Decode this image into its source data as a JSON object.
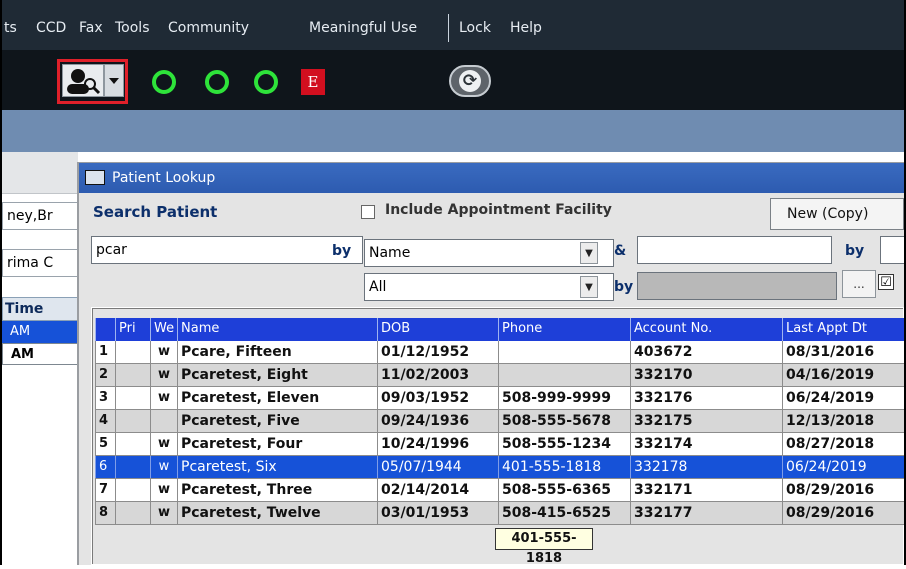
{
  "menu": {
    "items": [
      {
        "label": "ts"
      },
      {
        "label": "CCD"
      },
      {
        "label": "Fax"
      },
      {
        "label": "Tools"
      },
      {
        "label": "Community"
      },
      {
        "label": "Meaningful Use"
      },
      {
        "label": "Lock"
      },
      {
        "label": "Help"
      }
    ]
  },
  "toolbar": {
    "ef_icon_glyph": "E",
    "refresh_glyph": "⟳",
    "user_glyph": "👤",
    "dropdown_glyph": "▼"
  },
  "background_window": {
    "field1": "ney,Br",
    "field2": "rima C",
    "time_header": "Time",
    "rows": [
      "AM",
      "AM"
    ]
  },
  "dialog": {
    "title": "Patient Lookup",
    "search_patient_label": "Search Patient",
    "include_facility_label": "Include Appointment Facility",
    "new_copy_button": "New (Copy)",
    "search_value": "pcar",
    "by_label": "by",
    "by_label2": "by",
    "by_label3": "by",
    "amp_label": "&",
    "search_by_selected": "Name",
    "filter_selected": "All",
    "ellipsis": "...",
    "checkbox_glyph": "☑",
    "combo_arrow": "▼"
  },
  "grid": {
    "columns": [
      "",
      "Pri",
      "We",
      "Name",
      "DOB",
      "Phone",
      "Account No.",
      "Last Appt Dt"
    ],
    "rows": [
      {
        "num": "1",
        "pri": "",
        "we": "w",
        "name": "Pcare, Fifteen",
        "dob": "01/12/1952",
        "phone": "",
        "account": "403672",
        "last_appt": "08/31/2016"
      },
      {
        "num": "2",
        "pri": "",
        "we": "w",
        "name": "Pcaretest, Eight",
        "dob": "11/02/2003",
        "phone": "",
        "account": "332170",
        "last_appt": "04/16/2019"
      },
      {
        "num": "3",
        "pri": "",
        "we": "w",
        "name": "Pcaretest, Eleven",
        "dob": "09/03/1952",
        "phone": "508-999-9999",
        "account": "332176",
        "last_appt": "06/24/2019"
      },
      {
        "num": "4",
        "pri": "",
        "we": "",
        "name": "Pcaretest, Five",
        "dob": "09/24/1936",
        "phone": "508-555-5678",
        "account": "332175",
        "last_appt": "12/13/2018"
      },
      {
        "num": "5",
        "pri": "",
        "we": "w",
        "name": "Pcaretest, Four",
        "dob": "10/24/1996",
        "phone": "508-555-1234",
        "account": "332174",
        "last_appt": "08/27/2018"
      },
      {
        "num": "6",
        "pri": "",
        "we": "w",
        "name": "Pcaretest, Six",
        "dob": "05/07/1944",
        "phone": "401-555-1818",
        "account": "332178",
        "last_appt": "06/24/2019"
      },
      {
        "num": "7",
        "pri": "",
        "we": "w",
        "name": "Pcaretest, Three",
        "dob": "02/14/2014",
        "phone": "508-555-6365",
        "account": "332171",
        "last_appt": "08/29/2016"
      },
      {
        "num": "8",
        "pri": "",
        "we": "w",
        "name": "Pcaretest, Twelve",
        "dob": "03/01/1953",
        "phone": "508-415-6525",
        "account": "332177",
        "last_appt": "08/29/2016"
      }
    ],
    "selected_index": 5
  },
  "tooltip": {
    "text": "401-555-1818"
  },
  "colors": {
    "accent_blue": "#1e3fd8",
    "selected_row": "#1652d8",
    "status_green": "#2ee33a",
    "user_border_red": "#e0202a"
  }
}
